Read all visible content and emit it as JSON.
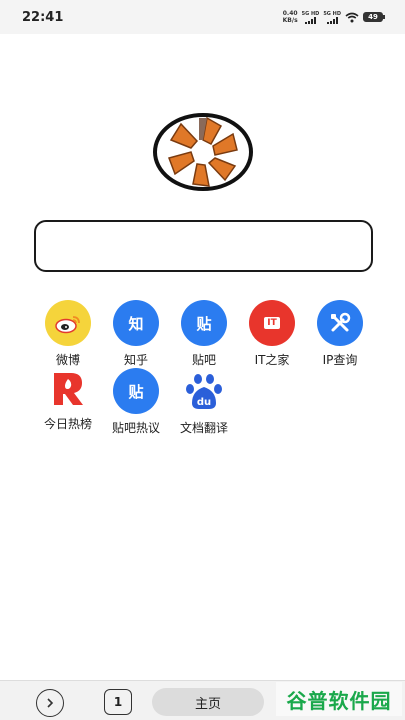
{
  "status_bar": {
    "time": "22:41",
    "net_speed": "0.40",
    "net_unit": "KB/s",
    "sim1_label": "5G HD",
    "sim2_label": "5G HD",
    "battery": "49"
  },
  "search": {
    "value": "",
    "placeholder": ""
  },
  "shortcuts": {
    "row1": [
      {
        "label": "微博",
        "icon": "weibo-icon",
        "color": "#f5d43b",
        "glyph": ""
      },
      {
        "label": "知乎",
        "icon": "zhihu-icon",
        "color": "#2b7cf0",
        "glyph": "知"
      },
      {
        "label": "贴吧",
        "icon": "tieba-icon",
        "color": "#2b7cf0",
        "glyph": "贴"
      },
      {
        "label": "IT之家",
        "icon": "ithome-icon",
        "color": "#e8352c",
        "glyph": "IT"
      },
      {
        "label": "IP查询",
        "icon": "ip-tools-icon",
        "color": "#2b7cf0",
        "glyph": ""
      }
    ],
    "row2": [
      {
        "label": "今日热榜",
        "icon": "hot-list-icon",
        "color": "#e8352c",
        "glyph": "R"
      },
      {
        "label": "贴吧热议",
        "icon": "tieba-hot-icon",
        "color": "#2b7cf0",
        "glyph": "贴"
      },
      {
        "label": "文档翻译",
        "icon": "baidu-translate-icon",
        "color": "#2b5fd9",
        "glyph": "du"
      }
    ]
  },
  "bottom_nav": {
    "tab_count": "1",
    "home_label": "主页"
  },
  "watermark": "谷普软件园"
}
